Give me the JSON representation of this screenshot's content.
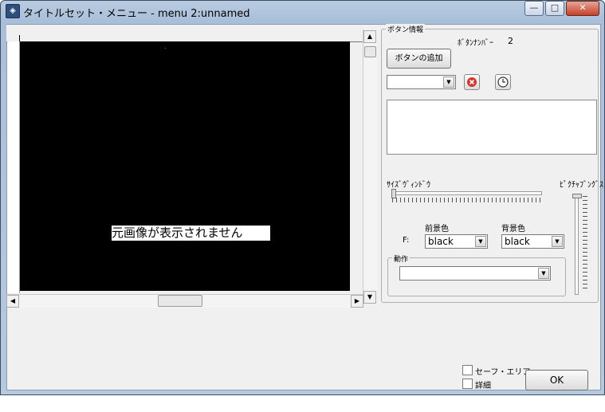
{
  "window": {
    "title": "タイトルセット・メニュー - menu 2:unnamed",
    "minimize_label": "—",
    "maximize_label": "□",
    "close_label": "✕"
  },
  "preview": {
    "no_image_text": "元画像が表示されません"
  },
  "button_info": {
    "group_label": "ボタン情報",
    "number_label": "ﾎﾞﾀﾝﾅﾝﾊﾞｰ",
    "number_value": "2",
    "add_button_label": "ボタンの追加",
    "select_value": "",
    "delete_icon": "delete-icon",
    "timer_icon": "clock-icon",
    "text_value": ""
  },
  "sliders": {
    "horizontal_label": "ｻｲｽﾞｳﾞｨﾝﾄﾞｳ",
    "vertical_label": "ﾋﾟｸﾁｬﾌﾞﾝｸﾞｽ"
  },
  "colors": {
    "row_label": "F:",
    "col1_label": "前景色",
    "col2_label": "背景色",
    "col1_value": "black",
    "col2_value": "black"
  },
  "action": {
    "group_label": "動作",
    "select_value": ""
  },
  "footer": {
    "safe_area_label": "セーフ・エリア",
    "detail_label": "詳細",
    "ok_label": "OK"
  },
  "theme": {
    "accent": "#a9bfd9",
    "close": "#c4412a",
    "preview_bg": "#000000"
  }
}
